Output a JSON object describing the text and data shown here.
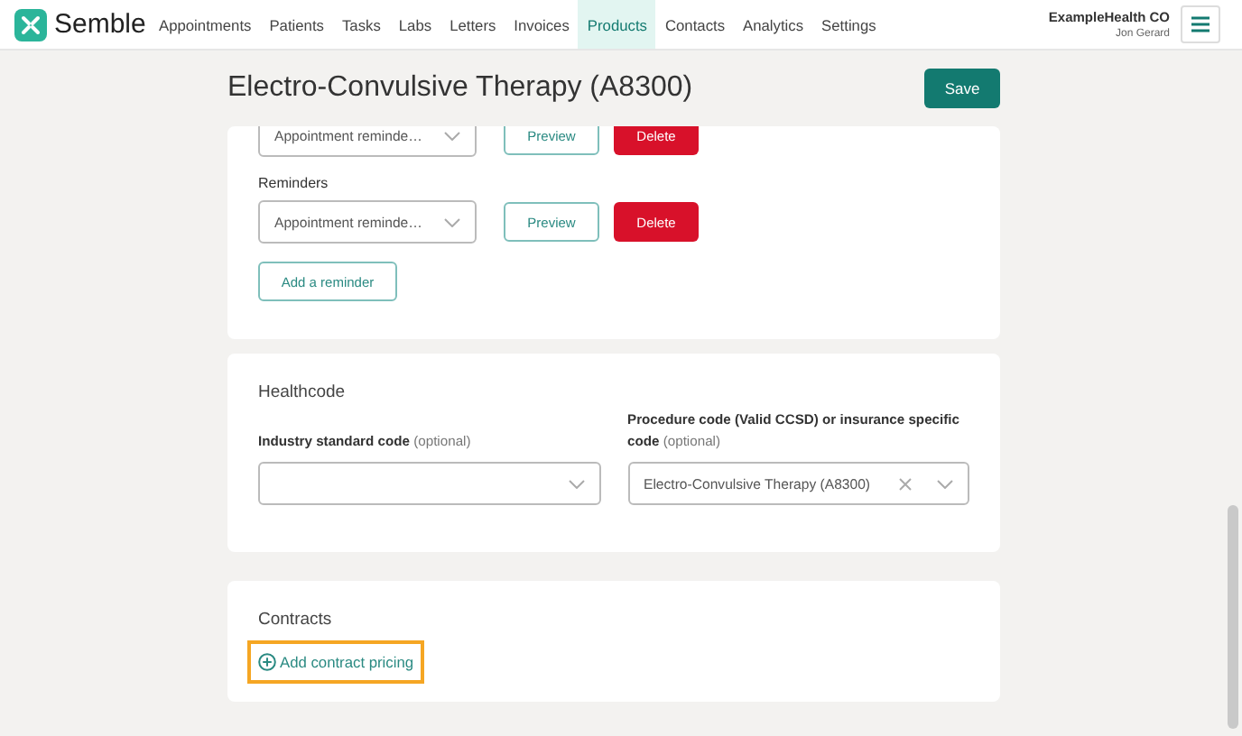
{
  "nav": {
    "logo": "Semble",
    "items": [
      {
        "label": "Appointments",
        "selected": false
      },
      {
        "label": "Patients",
        "selected": false
      },
      {
        "label": "Tasks",
        "selected": false
      },
      {
        "label": "Labs",
        "selected": false
      },
      {
        "label": "Letters",
        "selected": false
      },
      {
        "label": "Invoices",
        "selected": false
      },
      {
        "label": "Products",
        "selected": true
      },
      {
        "label": "Contacts",
        "selected": false
      },
      {
        "label": "Analytics",
        "selected": false
      },
      {
        "label": "Settings",
        "selected": false
      }
    ],
    "account": {
      "organisation": "ExampleHealth CO",
      "user": "Jon Gerard"
    }
  },
  "header": {
    "title": "Electro-Convulsive Therapy (A8300)",
    "save": "Save"
  },
  "reminders": {
    "rows": [
      {
        "label": null,
        "value": "Appointment reminde…",
        "preview": "Preview",
        "delete": "Delete"
      },
      {
        "label": "Reminders",
        "value": "Appointment reminde…",
        "preview": "Preview",
        "delete": "Delete"
      }
    ],
    "add": "Add a reminder"
  },
  "healthcode": {
    "title": "Healthcode",
    "fields": [
      {
        "label": "Industry standard code",
        "hint": "(optional)",
        "clearable": false
      },
      {
        "label": "Procedure code (Valid CCSD) or insurance specific code",
        "hint": "(optional)",
        "value": "Electro-Convulsive Therapy (A8300)",
        "clearable": true
      }
    ]
  },
  "contracts": {
    "title": "Contracts",
    "add": "Add contract pricing",
    "highlighted": true
  }
}
